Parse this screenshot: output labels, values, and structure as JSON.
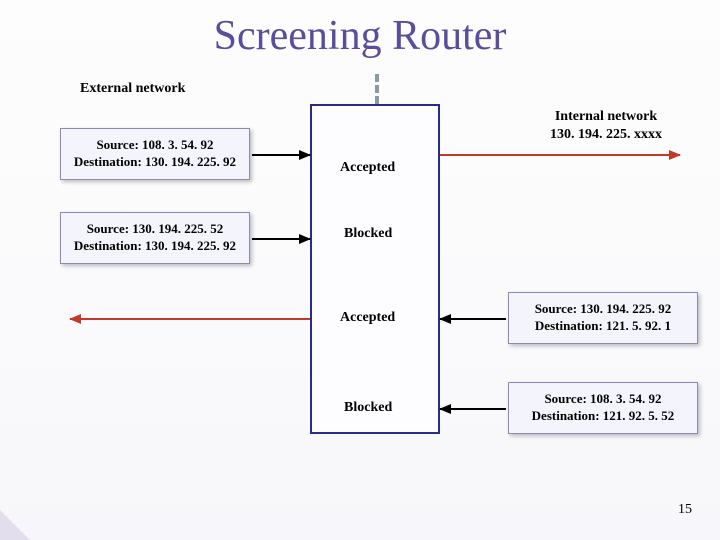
{
  "title": "Screening Router",
  "external_label": "External network",
  "internal_label_line1": "Internal network",
  "internal_label_line2": "130. 194. 225. xxxx",
  "packets": {
    "ext1": {
      "source": "Source: 108. 3. 54. 92",
      "dest": "Destination: 130. 194. 225. 92"
    },
    "ext2": {
      "source": "Source: 130. 194. 225. 52",
      "dest": "Destination: 130. 194. 225. 92"
    },
    "int1": {
      "source": "Source: 130. 194. 225. 92",
      "dest": "Destination: 121. 5. 92. 1"
    },
    "int2": {
      "source": "Source: 108. 3. 54. 92",
      "dest": "Destination: 121. 92. 5. 52"
    }
  },
  "status": {
    "row1": "Accepted",
    "row2": "Blocked",
    "row3": "Accepted",
    "row4": "Blocked"
  },
  "slide_number": "15"
}
